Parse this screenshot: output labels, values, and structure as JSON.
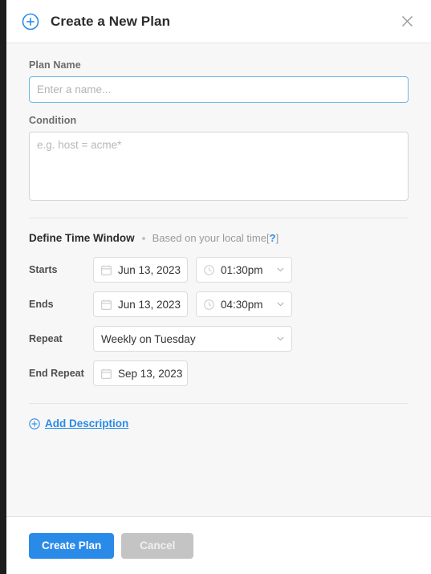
{
  "header": {
    "title": "Create a New Plan",
    "add_icon": "circle-plus-icon",
    "close_icon": "close-icon"
  },
  "form": {
    "plan_name": {
      "label": "Plan Name",
      "placeholder": "Enter a name...",
      "value": ""
    },
    "condition": {
      "label": "Condition",
      "placeholder": "e.g. host = acme*",
      "value": ""
    },
    "time_window": {
      "title": "Define Time Window",
      "note": "Based on your local time",
      "help_open_bracket": "[",
      "help_label": "?",
      "help_close_bracket": "]"
    },
    "starts": {
      "label": "Starts",
      "date": "Jun 13, 2023",
      "time": "01:30pm"
    },
    "ends": {
      "label": "Ends",
      "date": "Jun 13, 2023",
      "time": "04:30pm"
    },
    "repeat": {
      "label": "Repeat",
      "value": "Weekly on Tuesday"
    },
    "end_repeat": {
      "label": "End Repeat",
      "date": "Sep 13, 2023"
    },
    "add_description": {
      "label": "Add Description"
    }
  },
  "footer": {
    "submit_label": "Create Plan",
    "cancel_label": "Cancel"
  },
  "colors": {
    "accent": "#2a8ae8",
    "focus_border": "#6cb9e3",
    "disabled_button": "#c4c4c4",
    "body_background": "#f7f7f7"
  }
}
